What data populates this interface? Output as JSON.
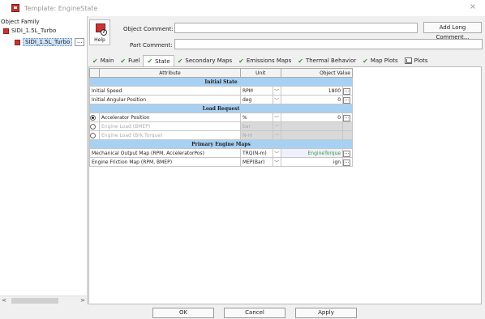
{
  "window": {
    "title": "Template: EngineState",
    "close": "×"
  },
  "tree": {
    "root_label": "Object Family",
    "items": [
      {
        "label": "SIDI_1.5L_Turbo",
        "selected": false
      },
      {
        "label": "SIDI_1.5L_Turbo",
        "selected": true,
        "more": "..."
      }
    ],
    "scroll_left": "<",
    "scroll_right": ">"
  },
  "header": {
    "help_label": "Help",
    "object_comment_label": "Object Comment:",
    "object_comment_value": "",
    "part_comment_label": "Part Comment:",
    "part_comment_value": "",
    "add_long_comment": "Add Long Comment..."
  },
  "tabs": [
    {
      "label": "Main",
      "icon": "check-icon"
    },
    {
      "label": "Fuel",
      "icon": "check-icon"
    },
    {
      "label": "State",
      "icon": "check-icon",
      "active": true
    },
    {
      "label": "Secondary Maps",
      "icon": "check-icon"
    },
    {
      "label": "Emissions Maps",
      "icon": "check-icon"
    },
    {
      "label": "Thermal Behavior",
      "icon": "check-icon"
    },
    {
      "label": "Map Plots",
      "icon": "check-icon"
    },
    {
      "label": "Plots",
      "icon": "plot-icon"
    }
  ],
  "table": {
    "headers": {
      "attribute": "Attribute",
      "unit": "Unit",
      "value": "Object Value"
    },
    "sections": [
      {
        "title": "Initial State",
        "rows": [
          {
            "attribute": "Initial Speed",
            "unit": "RPM",
            "value": "1800"
          },
          {
            "attribute": "Initial Angular Position",
            "unit": "deg",
            "value": "0"
          }
        ]
      },
      {
        "title": "Load Request",
        "rows": [
          {
            "attribute": "Accelerator Position",
            "unit": "%",
            "value": "0",
            "radio": "on"
          },
          {
            "attribute": "Engine Load (BMEP)",
            "unit": "bar",
            "value": "",
            "radio": "off",
            "disabled": true
          },
          {
            "attribute": "Engine Load (Brk.Torque)",
            "unit": "N-m",
            "value": "",
            "radio": "off",
            "disabled": true
          }
        ]
      },
      {
        "title": "Primary Engine Maps",
        "rows": [
          {
            "attribute": "Mechanical Output Map (RPM, AcceleratorPos)",
            "unit": "TRQ(N-m)",
            "value": "EngineTorque"
          },
          {
            "attribute": "Engine Friction Map (RPM, BMEP)",
            "unit": "MEP(Bar)",
            "value": "ign"
          }
        ]
      }
    ],
    "dots": "..."
  },
  "buttons": {
    "ok": "OK",
    "cancel": "Cancel",
    "apply": "Apply"
  },
  "colors": {
    "section_bg": "#a8d0f2",
    "check_green": "#3a9a2c",
    "ref_bg": "#eef0ff"
  }
}
